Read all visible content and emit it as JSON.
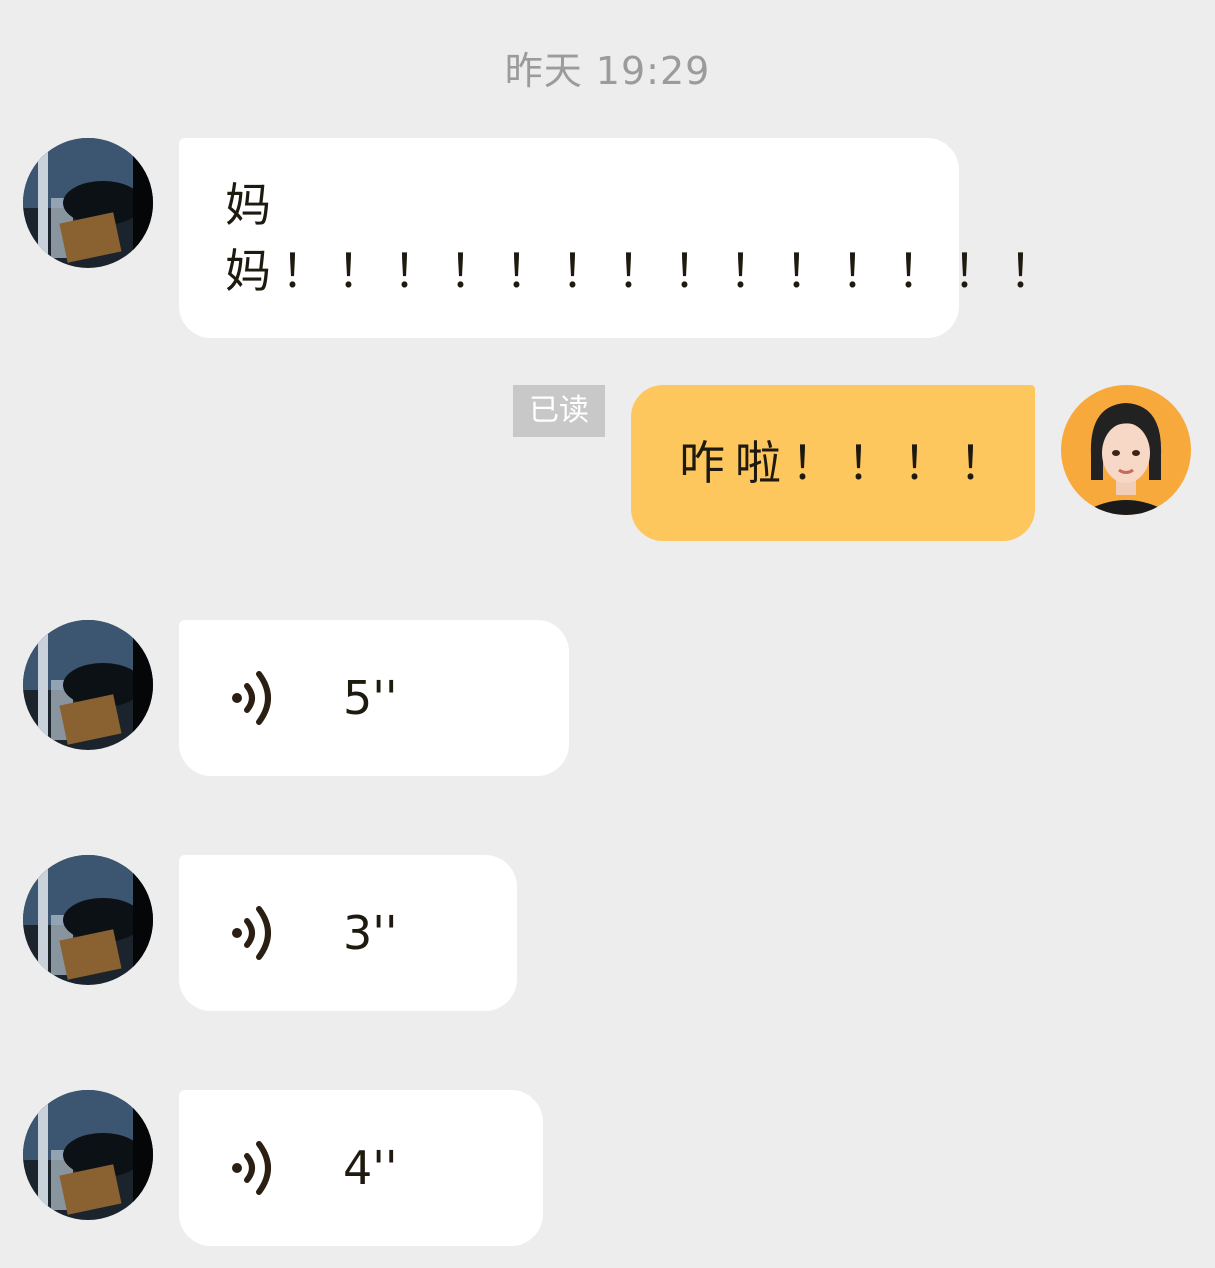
{
  "timestamp": "昨天 19:29",
  "messages": [
    {
      "text": "妈妈！！！！！！！！！！！！！！"
    },
    {
      "text": "咋啦！！！！",
      "read_status": "已读"
    }
  ],
  "voice_messages": [
    {
      "duration": "5''"
    },
    {
      "duration": "3''"
    },
    {
      "duration": "4''"
    }
  ],
  "colors": {
    "background": "#ededed",
    "incoming_bubble": "#ffffff",
    "outgoing_bubble": "#fec75e",
    "timestamp_text": "#9b9b9b",
    "read_badge": "#c8c8c8"
  },
  "icons": {
    "contact_avatar": "contact-avatar-photo",
    "my_avatar": "user-avatar-portrait",
    "voice": "voice-wave-icon"
  }
}
